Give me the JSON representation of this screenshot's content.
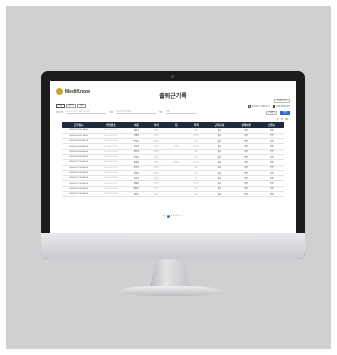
{
  "brand": {
    "name": "MediKnow"
  },
  "page_title": "출퇴근기록",
  "help_label": "도움말 보기",
  "filters": {
    "chips": [
      {
        "label": "오늘"
      },
      {
        "label": "이번주"
      },
      {
        "label": "이달"
      }
    ],
    "date_label": "조회기간",
    "date_value": "2024-07-01 ~ 2024-07-18",
    "name_label": "이름",
    "name_placeholder": "이름을 입력하세요",
    "dept_label": "부서",
    "dept_placeholder": "전체",
    "search_label": "검색",
    "excel_label": "엑셀"
  },
  "checks": [
    {
      "label": "초과근무 시간만 보기"
    },
    {
      "label": "근태 이상만 보기"
    }
  ],
  "tool_icons": [
    "print-icon",
    "refresh-icon",
    "settings-icon"
  ],
  "table": {
    "headers": [
      "근무일시",
      "연락번호",
      "이름",
      "부서",
      "팀",
      "직책",
      "근태구분",
      "상태여부",
      "신청시"
    ],
    "rows": [
      [
        "2024-07-18 11:00:00",
        "010-1234-5678",
        "김민수",
        "진료부",
        "",
        "의사",
        "출근",
        "확인",
        "확인"
      ],
      [
        "2024-07-18 11:30:00",
        "010-2345-6789",
        "이영희",
        "간호부",
        "",
        "간호사",
        "출근",
        "확인",
        "확인"
      ],
      [
        "2024-07-18 09:00:10",
        "010-3456-7890",
        "박지훈",
        "원무과",
        "",
        "사원",
        "출근",
        "확인",
        "확인"
      ],
      [
        "2024-07-18 09:00:03",
        "010-4567-8901",
        "최수진",
        "간호부",
        "수술팀",
        "간호사",
        "출근",
        "확인",
        "확인"
      ],
      [
        "2024-07-18 09:00:00",
        "010-5678-9012",
        "정우성",
        "진료부",
        "",
        "의사",
        "출근",
        "확인",
        "확인"
      ],
      [
        "2024-07-18 09:00:00",
        "010-6789-0123",
        "한지민",
        "검사실",
        "",
        "기사",
        "출근",
        "확인",
        "확인"
      ],
      [
        "2024-07-17 20:00:00",
        "010-7890-1234",
        "오세훈",
        "간호부",
        "병동팀",
        "간호사",
        "퇴근",
        "확인",
        "확인"
      ],
      [
        "2024-07-17 18:00:00",
        "010-8901-2345",
        "윤서연",
        "원무과",
        "",
        "사원",
        "퇴근",
        "확인",
        "확인"
      ],
      [
        "2024-07-17 18:00:00",
        "010-9012-3456",
        "강동원",
        "진료부",
        "",
        "의사",
        "퇴근",
        "확인",
        "확인"
      ],
      [
        "2024-07-17 18:00:00",
        "010-0123-4567",
        "송하늘",
        "검사실",
        "",
        "기사",
        "퇴근",
        "확인",
        "확인"
      ],
      [
        "2024-07-17 09:00:00",
        "010-1111-2222",
        "임채원",
        "간호부",
        "",
        "간호사",
        "출근",
        "확인",
        "확인"
      ],
      [
        "2024-07-17 09:00:00",
        "010-3333-4444",
        "배준호",
        "원무과",
        "",
        "사원",
        "출근",
        "확인",
        "확인"
      ],
      [
        "2024-07-17 09:00:00",
        "010-5555-6666",
        "신유나",
        "진료부",
        "",
        "의사",
        "출근",
        "확인",
        "확인"
      ]
    ]
  },
  "pagination": {
    "first": "«",
    "prev": "‹",
    "pages": [
      "1",
      "2",
      "3",
      "4",
      "5"
    ],
    "current": "1",
    "next": "›",
    "last": "»"
  }
}
